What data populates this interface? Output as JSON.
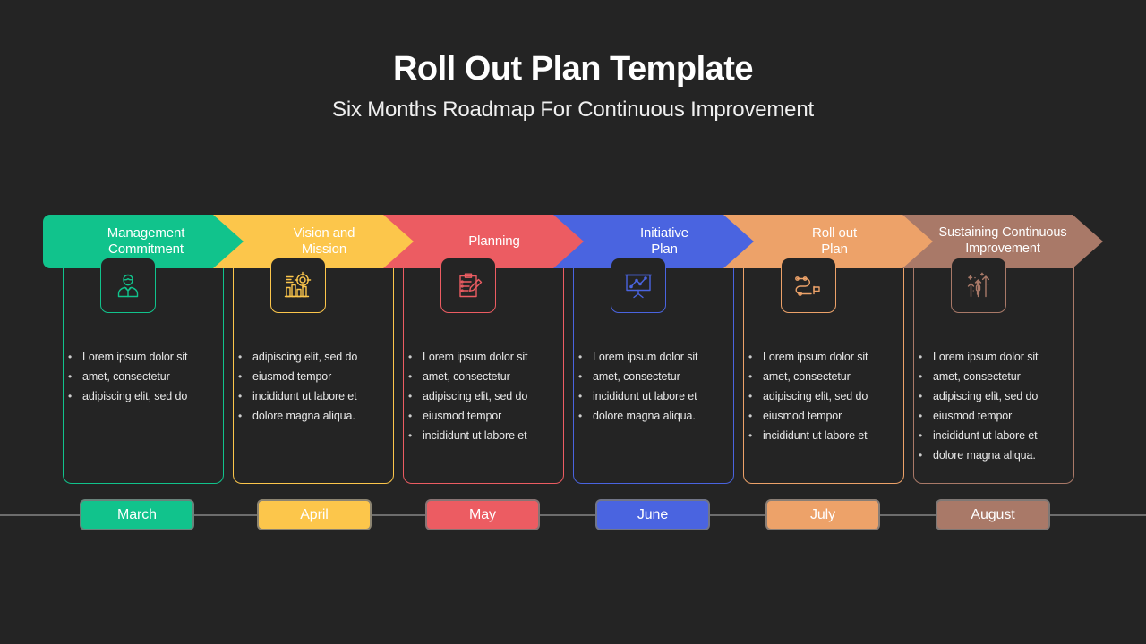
{
  "header": {
    "title": "Roll Out Plan Template",
    "subtitle": "Six Months Roadmap For Continuous Improvement"
  },
  "colors": {
    "background": "#242424",
    "stage1": "#11c38c",
    "stage2": "#fcc64b",
    "stage3": "#ec5c62",
    "stage4": "#4a64e0",
    "stage5": "#eda269",
    "stage6": "#a97968",
    "timeline_line": "#6d6d6d",
    "bullet_text": "#e8e8e8",
    "title_text": "#ffffff"
  },
  "stages": [
    {
      "id": "management-commitment",
      "title": "Management\nCommitment",
      "color": "#11c38c",
      "icon": "businessman-icon",
      "month": "March",
      "bullets": [
        "Lorem ipsum dolor sit",
        " amet, consectetur",
        "adipiscing elit, sed do"
      ]
    },
    {
      "id": "vision-and-mission",
      "title": "Vision and\nMission",
      "color": "#fcc64b",
      "icon": "target-chart-icon",
      "month": "April",
      "bullets": [
        "adipiscing elit, sed  do",
        "eiusmod tempor",
        "incididunt ut labore et",
        "dolore magna aliqua."
      ]
    },
    {
      "id": "planning",
      "title": "Planning",
      "color": "#ec5c62",
      "icon": "clipboard-pencil-icon",
      "month": "May",
      "bullets": [
        "Lorem ipsum dolor sit",
        " amet, consectetur",
        "adipiscing elit, sed  do",
        "eiusmod tempor",
        "incididunt ut labore et"
      ]
    },
    {
      "id": "initiative-plan",
      "title": "Initiative\nPlan",
      "color": "#4a64e0",
      "icon": "presentation-board-icon",
      "month": "June",
      "bullets": [
        "Lorem ipsum dolor sit",
        " amet, consectetur",
        "incididunt ut labore et",
        "dolore magna aliqua."
      ]
    },
    {
      "id": "roll-out-plan",
      "title": "Roll out\nPlan",
      "color": "#eda269",
      "icon": "route-flag-icon",
      "month": "July",
      "bullets": [
        "Lorem ipsum dolor sit",
        " amet, consectetur",
        "adipiscing elit, sed  do",
        "eiusmod tempor",
        "incididunt ut labore et"
      ]
    },
    {
      "id": "sustaining-continuous-improvement",
      "title": "Sustaining Continuous\nImprovement",
      "color": "#a97968",
      "icon": "growth-arrows-icon",
      "month": "August",
      "bullets": [
        "Lorem ipsum dolor sit",
        " amet, consectetur",
        "adipiscing elit, sed  do",
        "eiusmod tempor",
        "incididunt ut labore et",
        "dolore magna aliqua."
      ]
    }
  ]
}
